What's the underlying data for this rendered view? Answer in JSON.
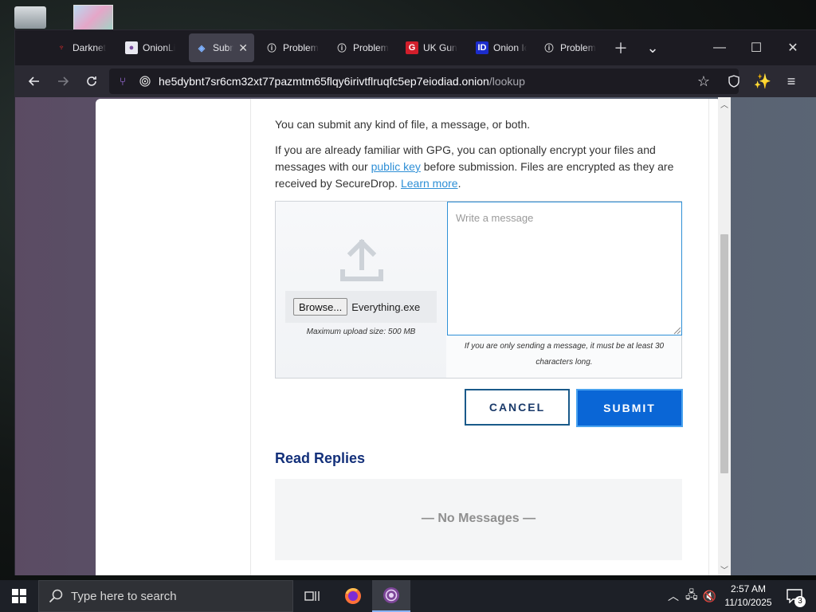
{
  "browser": {
    "tabs": [
      {
        "title": "Darknet",
        "favicon": "darknet-icon",
        "active": false
      },
      {
        "title": "OnionLi",
        "favicon": "onionlinks-icon",
        "active": false
      },
      {
        "title": "Subm",
        "favicon": "securedrop-icon",
        "active": true
      },
      {
        "title": "Problem",
        "favicon": "info-icon",
        "active": false
      },
      {
        "title": "Problem",
        "favicon": "info-icon",
        "active": false
      },
      {
        "title": "UK Gun",
        "favicon": "g-icon",
        "active": false
      },
      {
        "title": "Onion Ic",
        "favicon": "id-icon",
        "active": false
      },
      {
        "title": "Problem",
        "favicon": "info-icon",
        "active": false
      }
    ],
    "tab_favicon_letters": {
      "g": "G",
      "id": "ID"
    },
    "url_host": "he5dybnt7sr6cm32xt77pazmtm65flqy6irivtflruqfc5ep7eiodiad.onion",
    "url_path": "/lookup"
  },
  "page": {
    "intro": "You can submit any kind of file, a message, or both.",
    "gpg_text_1": "If you are already familiar with GPG, you can optionally encrypt your files and messages with our ",
    "public_key_link": "public key",
    "gpg_text_2": " before submission. Files are encrypted as they are received by SecureDrop. ",
    "learn_more_link": "Learn more",
    "gpg_text_3": ".",
    "browse_label": "Browse...",
    "file_name": "Everything.exe",
    "max_upload": "Maximum upload size: 500 MB",
    "message_placeholder": "Write a message",
    "message_note": "If you are only sending a message, it must be at least 30 characters long.",
    "cancel_label": "CANCEL",
    "submit_label": "SUBMIT",
    "replies_title": "Read Replies",
    "no_messages": "— No Messages —"
  },
  "taskbar": {
    "search_placeholder": "Type here to search",
    "time": "2:57 AM",
    "date": "11/10/2025",
    "notification_count": "3"
  },
  "colors": {
    "accent": "#0a66d6",
    "link": "#2e8fd6",
    "heading": "#13307a"
  }
}
